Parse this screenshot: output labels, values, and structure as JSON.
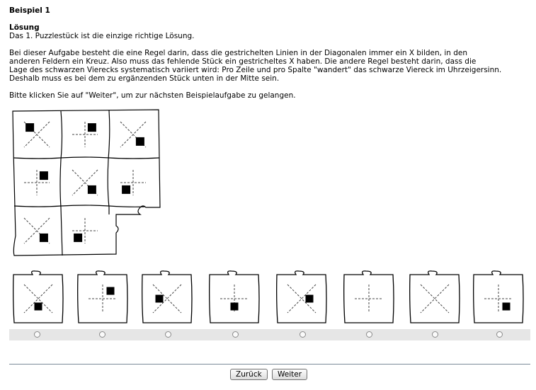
{
  "header": {
    "title": "Beispiel 1",
    "solution_label": "Lösung",
    "solution_text": "Das 1. Puzzlestück ist die einzige richtige Lösung."
  },
  "explanation": [
    "Bei dieser Aufgabe besteht die eine Regel darin, dass die gestrichelten Linien in der Diagonalen immer ein X bilden, in den",
    "anderen Feldern ein Kreuz. Also muss das fehlende Stück ein gestricheltes X haben. Die andere Regel besteht darin, dass die",
    "Lage des schwarzen Vierecks systematisch variiert wird: Pro Zeile und pro Spalte \"wandert\" das schwarze Viereck im Uhrzeigersinn.",
    "Deshalb muss es bei dem zu ergänzenden Stück unten in der Mitte sein."
  ],
  "instruction": "Bitte klicken Sie auf \"Weiter\", um zur nächsten Beispielaufgabe zu gelangen.",
  "puzzle_grid": [
    {
      "cell": "r1c1",
      "pattern": "x",
      "square": "top-left"
    },
    {
      "cell": "r1c2",
      "pattern": "plus",
      "square": "top-right"
    },
    {
      "cell": "r1c3",
      "pattern": "x",
      "square": "bottom-right"
    },
    {
      "cell": "r2c1",
      "pattern": "plus",
      "square": "top-right"
    },
    {
      "cell": "r2c2",
      "pattern": "x",
      "square": "bottom-right"
    },
    {
      "cell": "r2c3",
      "pattern": "plus",
      "square": "bottom-left"
    },
    {
      "cell": "r3c1",
      "pattern": "x",
      "square": "bottom-right"
    },
    {
      "cell": "r3c2",
      "pattern": "plus",
      "square": "bottom-left"
    },
    {
      "cell": "r3c3",
      "pattern": "missing",
      "square": "none"
    }
  ],
  "options": [
    {
      "pattern": "x",
      "square": "bottom-center"
    },
    {
      "pattern": "plus",
      "square": "top-right"
    },
    {
      "pattern": "x",
      "square": "middle-left"
    },
    {
      "pattern": "plus",
      "square": "bottom-center"
    },
    {
      "pattern": "x",
      "square": "middle-right"
    },
    {
      "pattern": "plus",
      "square": "none"
    },
    {
      "pattern": "x",
      "square": "none"
    },
    {
      "pattern": "plus",
      "square": "bottom-right"
    }
  ],
  "nav": {
    "back_label": "Zurück",
    "next_label": "Weiter"
  }
}
